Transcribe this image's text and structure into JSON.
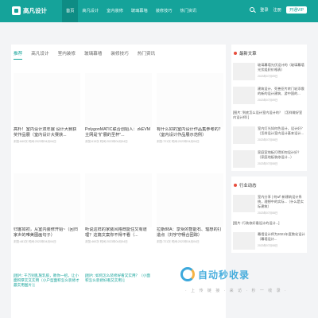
{
  "header": {
    "logo_text": "高凡设计",
    "nav": [
      "首页",
      "高凡设计",
      "室内装修",
      "玻璃幕墙",
      "装修技巧",
      "热门资讯"
    ],
    "login": "登录",
    "register": "注册",
    "vip": "开通VIP"
  },
  "main": {
    "tabs": [
      "推荐",
      "高凡设计",
      "室内装修",
      "玻璃幕墙",
      "装修技巧",
      "热门资讯"
    ],
    "cards": [
      {
        "title": "高朴！室内设计双年展 设计大赛获奖作品展（室内设计大赛获...",
        "meta": "浏览:840次    时间:2023年04月04日"
      },
      {
        "title": "PolygonMATIC联合创始人：zkEVM 主网是\"扩展的圣杯\"...",
        "meta": "浏览:615次    时间:2023年04月04日"
      },
      {
        "title": "有什么好的室内设计作品集参考的？（室内设计作品展示范例）",
        "meta": "浏览:721次    时间:2023年04月04日"
      },
      {
        "title": "归客如初，从室内装修开始~（回归家乡的唯美图画句子）",
        "meta": "浏览:481次    时间:2023年04月04日"
      },
      {
        "title": "听说这样的家装风格既能住又有道理？这篇文案你不得不看（...",
        "meta": "浏览:460次    时间:2023年04月04日"
      },
      {
        "title": "拉斯88A：享受的智能石、理想的打造点（刘宇守畅合团踪）",
        "meta": "浏览:721次    时间:2023年04月04日"
      },
      {
        "title": "[图片: 千万别乱施乳胶，教你一招，让小面积厚实又实用（小户型面积怎么装修才最实用图片）]"
      },
      {
        "title": "[图片: 如何怎么装修好看又实用？（小面积怎么装修好看又实用）]"
      }
    ]
  },
  "sidebar": {
    "latest_title": "最新文章",
    "latest": [
      {
        "text": "玻璃幕墙光伏设计的（玻璃幕墙光伏组织价格表）",
        "date": "2023年07月09日"
      },
      {
        "text": "建筑设计、死善亚片转门轮添俄的新的设计建筑、游中国的...",
        "date": "2023年07月09日"
      },
      {
        "text": "[图片: 到底怎么设计室内设计的？（怎样做好室内设计师）]",
        "date": ""
      },
      {
        "text": "室内灯光如何色设计，设计好？（怎样设计室内设计基本设计...",
        "date": "2023年07月08日"
      },
      {
        "text": "家庭室地板打得如何设计好？（家庭地板装修设计...）",
        "date": "2023年07月08日"
      }
    ],
    "news_title": "行业动态",
    "news": [
      {
        "text": "室内分享 | 何wf' 新建筑设计系统，理想中的实际...（什么是实际建筑）",
        "date": "2023年07月08日"
      },
      {
        "text": "[图片: 行装修好看设计的设计...]",
        "date": ""
      }
    ],
    "foot": {
      "text": "幕墙设计师为2021年度数化设计（幕墙设计...",
      "date": "2023年07月08日"
    }
  },
  "watermark": {
    "text": "自动秒收录",
    "sub": "· 上 传 链 接 · 来 访 · 秒 一 收 录 ·"
  },
  "colors": {
    "brand": "#15a39a"
  }
}
